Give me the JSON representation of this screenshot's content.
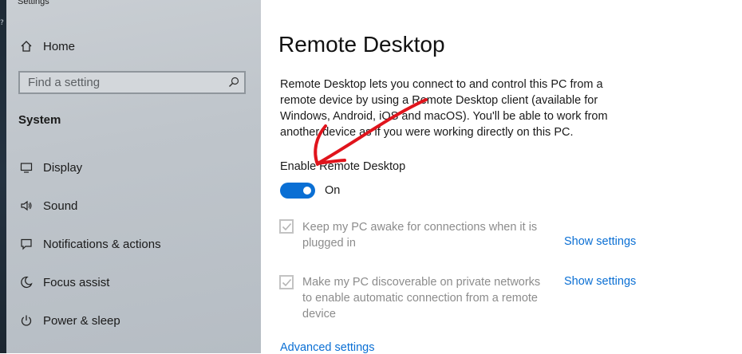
{
  "window": {
    "title": "Settings"
  },
  "desktop": {
    "glyph": "?"
  },
  "sidebar": {
    "home_label": "Home",
    "search_placeholder": "Find a setting",
    "section_title": "System",
    "items": [
      {
        "label": "Display",
        "icon": "display-icon"
      },
      {
        "label": "Sound",
        "icon": "sound-icon"
      },
      {
        "label": "Notifications & actions",
        "icon": "notifications-icon"
      },
      {
        "label": "Focus assist",
        "icon": "focus-assist-icon"
      },
      {
        "label": "Power & sleep",
        "icon": "power-icon"
      }
    ]
  },
  "main": {
    "title": "Remote Desktop",
    "description": "Remote Desktop lets you connect to and control this PC from a remote device by using a Remote Desktop client (available for Windows, Android, iOS and macOS). You'll be able to work from another device as if you were working directly on this PC.",
    "toggle": {
      "label": "Enable Remote Desktop",
      "state": "On"
    },
    "options": [
      {
        "text": "Keep my PC awake for connections when it is plugged in",
        "checked": true,
        "link": "Show settings"
      },
      {
        "text": "Make my PC discoverable on private networks to enable automatic connection from a remote device",
        "checked": true,
        "link": "Show settings"
      }
    ],
    "advanced_link": "Advanced settings"
  },
  "colors": {
    "accent": "#0a6fd4",
    "annotation": "#e0141c",
    "sidebar_bg": "#c2c8ce"
  }
}
